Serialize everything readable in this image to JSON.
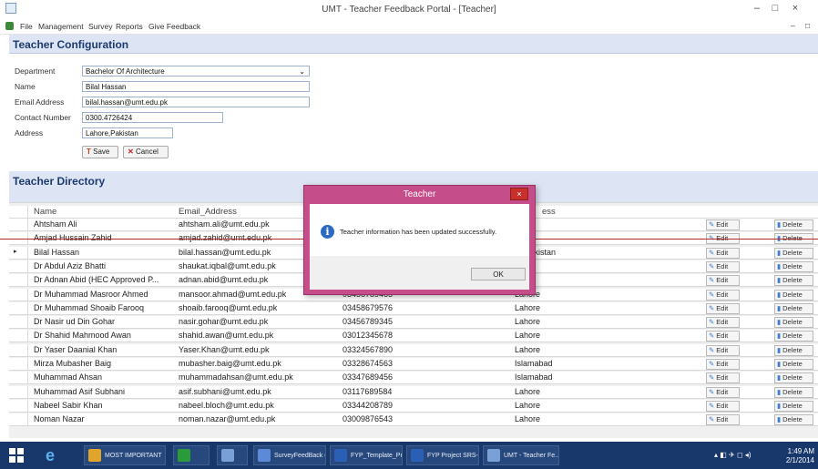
{
  "window": {
    "title": "UMT - Teacher Feedback Portal - [Teacher]",
    "minimize": "–",
    "restore": "□",
    "close": "×",
    "mdi_minimize": "–",
    "mdi_restore": "□"
  },
  "menu": [
    "File",
    "Management",
    "Survey",
    "Reports",
    "Give Feedback"
  ],
  "config": {
    "title": "Teacher Configuration",
    "department_label": "Department",
    "department_value": "Bachelor Of Architecture",
    "name_label": "Name",
    "name_value": "Bilal Hassan",
    "email_label": "Email Address",
    "email_value": "bilal.hassan@umt.edu.pk",
    "contact_label": "Contact Number",
    "contact_value": "0300.4726424",
    "address_label": "Address",
    "address_value": "Lahore,Pakistan",
    "save_label": "Save",
    "cancel_label": "Cancel"
  },
  "directory": {
    "title": "Teacher Directory",
    "columns": [
      "Name",
      "Email_Address",
      "",
      "ess"
    ],
    "edit_label": "Edit",
    "delete_label": "Delete",
    "rows": [
      {
        "name": "Ahtsham Ali",
        "email": "ahtsham.ali@umt.edu.pk",
        "contact": "",
        "address": "re"
      },
      {
        "name": "Amjad Hussain Zahid",
        "email": "amjad.zahid@umt.edu.pk",
        "contact": "",
        "address": "re"
      },
      {
        "name": "Bilal Hassan",
        "email": "bilal.hassan@umt.edu.pk",
        "contact": "",
        "address": "re,Pakistan"
      },
      {
        "name": "Dr Abdul Aziz Bhatti",
        "email": "shaukat.iqbal@umt.edu.pk",
        "contact": "",
        "address": "re"
      },
      {
        "name": "Dr Adnan Abid (HEC Approved P...",
        "email": "adnan.abid@umt.edu.pk",
        "contact": "",
        "address": "re"
      },
      {
        "name": "Dr Muhammad Masroor Ahmed",
        "email": "mansoor.ahmad@umt.edu.pk",
        "contact": "03456789465",
        "address": "Lahore"
      },
      {
        "name": "Dr Muhammad Shoaib Farooq",
        "email": "shoaib.farooq@umt.edu.pk",
        "contact": "03458679576",
        "address": "Lahore"
      },
      {
        "name": "Dr Nasir ud Din Gohar",
        "email": "nasir.gohar@umt.edu.pk",
        "contact": "03456789345",
        "address": "Lahore"
      },
      {
        "name": "Dr Shahid Mahmood Awan",
        "email": "shahid.awan@umt.edu.pk",
        "contact": "03012345678",
        "address": "Lahore"
      },
      {
        "name": "Dr Yaser Daanial Khan",
        "email": "Yaser.Khan@umt.edu.pk",
        "contact": "03324567890",
        "address": "Lahore"
      },
      {
        "name": "Mirza Mubasher Baig",
        "email": "mubasher.baig@umt.edu.pk",
        "contact": "03328674563",
        "address": "Islamabad"
      },
      {
        "name": "Muhammad Ahsan",
        "email": "muhammadahsan@umt.edu.pk",
        "contact": "03347689456",
        "address": "Islamabad"
      },
      {
        "name": "Muhammad Asif Subhani",
        "email": "asif.subhani@umt.edu.pk",
        "contact": "03117689584",
        "address": "Lahore"
      },
      {
        "name": "Nabeel Sabir Khan",
        "email": "nabeel.bloch@umt.edu.pk",
        "contact": "03344208789",
        "address": "Lahore"
      },
      {
        "name": "Noman Nazar",
        "email": "noman.nazar@umt.edu.pk",
        "contact": "03009876543",
        "address": "Lahore"
      }
    ]
  },
  "dialog": {
    "title": "Teacher",
    "message": "Teacher information has been updated successfully.",
    "ok_label": "OK",
    "close": "×"
  },
  "taskbar": {
    "items": [
      {
        "label": "MOST IMPORTANT",
        "color": "#e0a52a"
      },
      {
        "label": "",
        "color": "#2b9a3a"
      },
      {
        "label": "",
        "color": "#7aa0d8"
      },
      {
        "label": "SurveyFeedBack (...",
        "color": "#5a8ad8"
      },
      {
        "label": "FYP_Template_Pr...",
        "color": "#2b5fb5"
      },
      {
        "label": "FYP Project SRS-2...",
        "color": "#2b5fb5"
      },
      {
        "label": "UMT - Teacher Fe...",
        "color": "#7aa0d8"
      }
    ],
    "time": "1:49 AM",
    "date": "2/1/2014"
  },
  "colors": {
    "accent": "#1d3a6e",
    "dialog_frame": "#c54d8a",
    "taskbar": "#18386b"
  }
}
